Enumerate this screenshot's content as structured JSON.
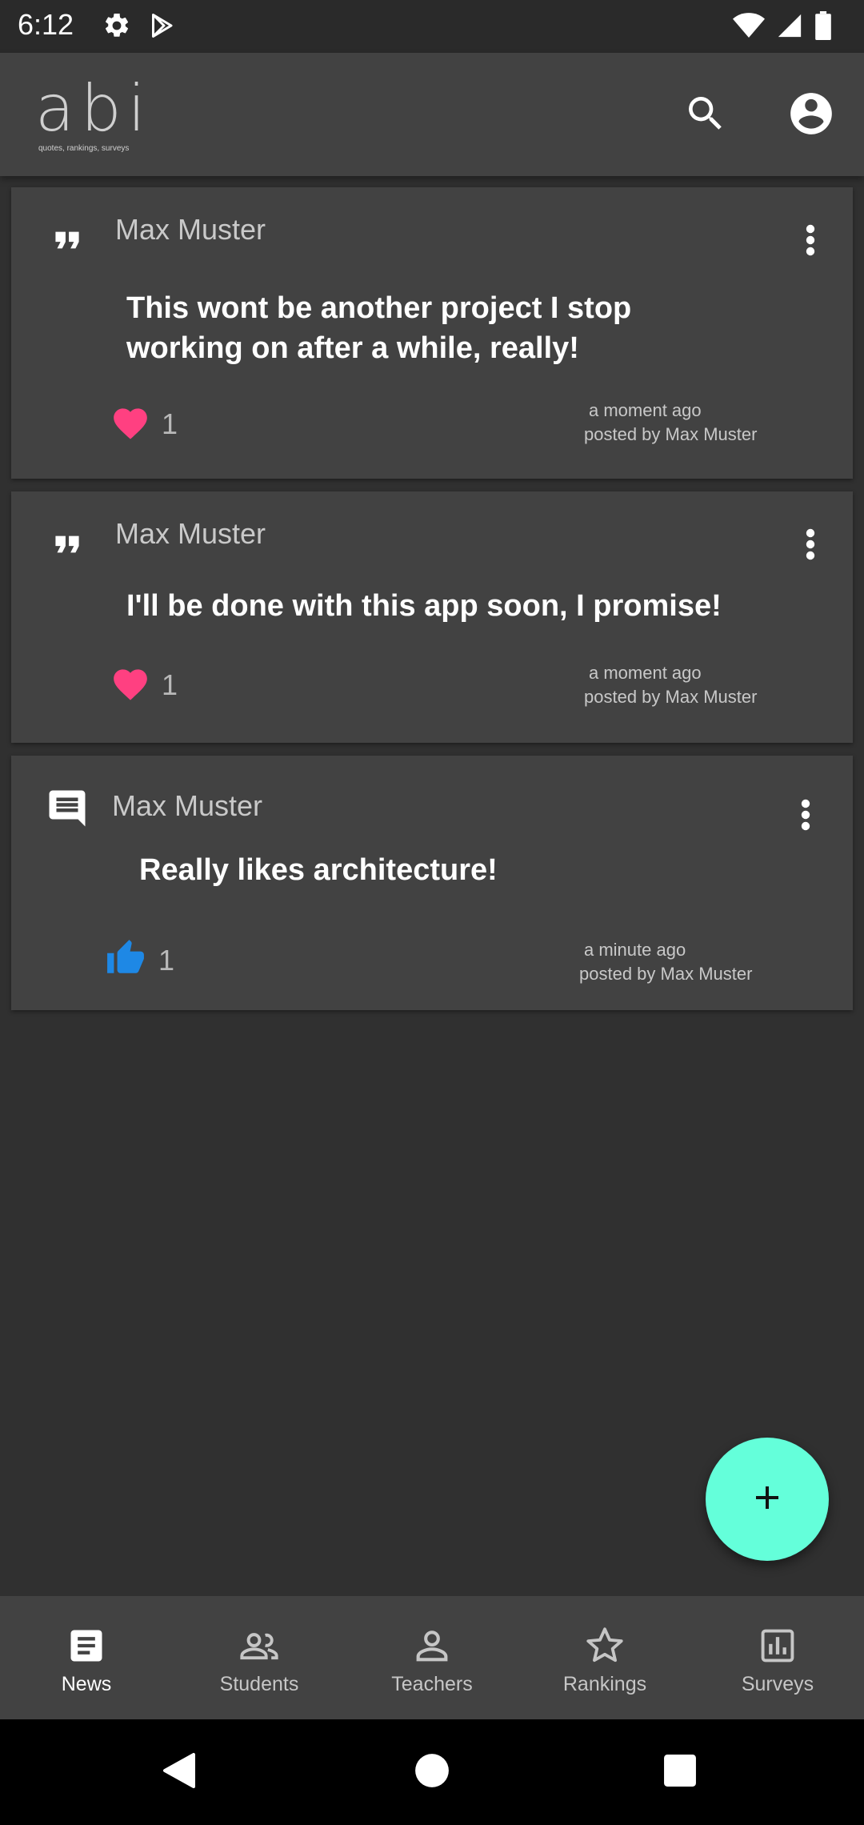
{
  "status_bar": {
    "time": "6:12",
    "icons": [
      "settings-icon",
      "play-store-icon",
      "wifi-icon",
      "signal-icon",
      "battery-icon"
    ]
  },
  "app_bar": {
    "logo_text": "abi",
    "logo_subtitle": "quotes, rankings, surveys",
    "actions": [
      "search-icon",
      "account-icon"
    ]
  },
  "posts": [
    {
      "type_icon": "quote-icon",
      "author": "Max Muster",
      "body": "This wont be another project I stop working on after a while, really!",
      "reaction_icon": "heart-icon",
      "reaction_count": "1",
      "time": "a moment ago",
      "posted_by": "posted by Max Muster"
    },
    {
      "type_icon": "quote-icon",
      "author": "Max Muster",
      "body": "I'll be done with this app soon, I promise!",
      "reaction_icon": "heart-icon",
      "reaction_count": "1",
      "time": "a moment ago",
      "posted_by": "posted by Max Muster"
    },
    {
      "type_icon": "comment-icon",
      "author": "Max Muster",
      "body": "Really likes architecture!",
      "reaction_icon": "thumbs-up-icon",
      "reaction_count": "1",
      "time": "a minute ago",
      "posted_by": "posted by Max Muster"
    }
  ],
  "fab": {
    "icon": "plus-icon"
  },
  "bottom_nav": {
    "items": [
      {
        "label": "News",
        "icon": "article-icon",
        "active": true
      },
      {
        "label": "Students",
        "icon": "people-icon",
        "active": false
      },
      {
        "label": "Teachers",
        "icon": "person-icon",
        "active": false
      },
      {
        "label": "Rankings",
        "icon": "star-icon",
        "active": false
      },
      {
        "label": "Surveys",
        "icon": "poll-icon",
        "active": false
      }
    ]
  },
  "colors": {
    "background": "#303030",
    "surface": "#424242",
    "accent": "#64ffda",
    "heart": "#ff4081",
    "thumb": "#1e88e5"
  }
}
